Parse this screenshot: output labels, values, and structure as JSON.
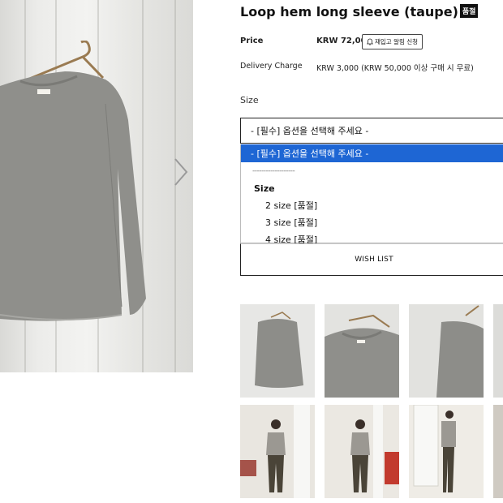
{
  "product": {
    "title": "Loop hem long sleeve (taupe)",
    "soldout_badge": "품절"
  },
  "price": {
    "label": "Price",
    "value": "KRW 72,000",
    "restock_button": "재입고 알림 신청"
  },
  "delivery": {
    "label": "Delivery Charge",
    "value": "KRW 3,000 (KRW 50,000 이상 구매 시 무료)"
  },
  "size": {
    "label": "Size",
    "select_value": "- [필수] 옵션을 선택해 주세요 -",
    "dropdown": {
      "selected": "- [필수] 옵션을 선택해 주세요 -",
      "separator": "-------------------",
      "group": "Size",
      "options": [
        "2 size [품절]",
        "3 size [품절]",
        "4 size [품절]"
      ]
    }
  },
  "wishlist": {
    "label": "WISH LIST"
  },
  "colors": {
    "highlight": "#1e66d4",
    "shirt": "#8f8f8b",
    "dark": "#111111"
  },
  "icons": {
    "next": "chevron-right-icon",
    "bell": "bell-icon"
  }
}
